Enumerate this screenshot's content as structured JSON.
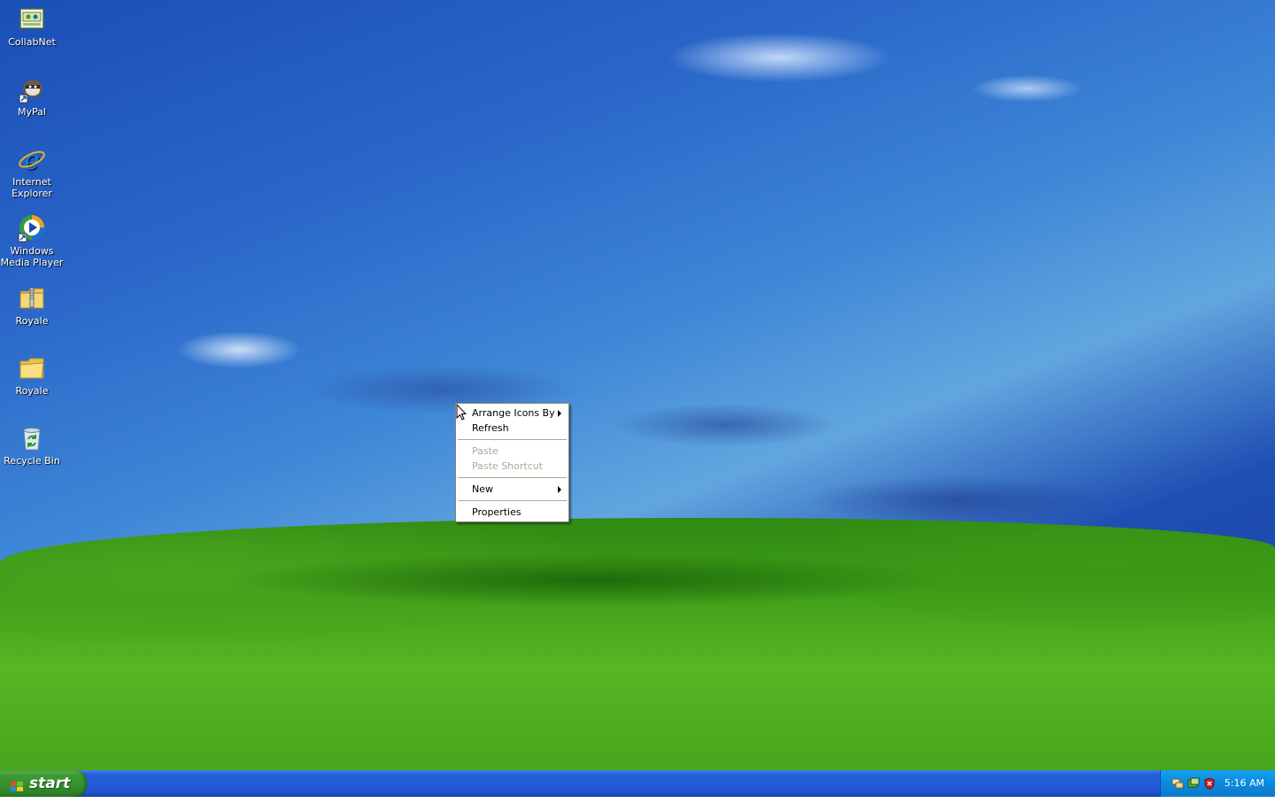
{
  "desktop_icons": [
    {
      "label": "CollabNet",
      "icon": "collabnet-icon"
    },
    {
      "label": "MyPal",
      "icon": "mypal-icon"
    },
    {
      "label": "Internet Explorer",
      "icon": "internet-explorer-icon"
    },
    {
      "label": "Windows Media Player",
      "icon": "windows-media-player-icon"
    },
    {
      "label": "Royale",
      "icon": "zip-folder-icon"
    },
    {
      "label": "Royale",
      "icon": "folder-icon"
    },
    {
      "label": "Recycle Bin",
      "icon": "recycle-bin-icon"
    }
  ],
  "context_menu": {
    "arrange_icons_by": "Arrange Icons By",
    "refresh": "Refresh",
    "paste": "Paste",
    "paste_shortcut": "Paste Shortcut",
    "new": "New",
    "properties": "Properties"
  },
  "taskbar": {
    "start_label": "start",
    "clock": "5:16 AM",
    "tray_icons": [
      "network-icon",
      "antivirus-icon",
      "security-shield-icon"
    ]
  },
  "colors": {
    "taskbar_blue": "#245ddb",
    "start_green": "#3c9b35",
    "tray_blue": "#0c8ade",
    "menu_disabled": "#aca899"
  }
}
